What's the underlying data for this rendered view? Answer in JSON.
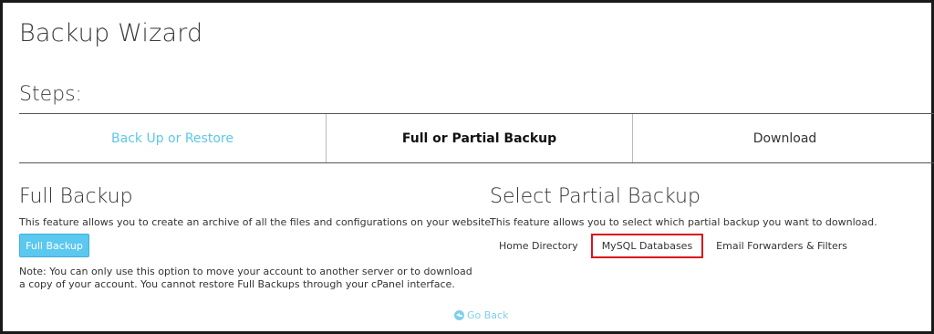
{
  "page": {
    "title": "Backup Wizard",
    "steps_heading": "Steps:"
  },
  "steps": [
    {
      "label": "Back Up or Restore",
      "state": "completed"
    },
    {
      "label": "Full or Partial Backup",
      "state": "current"
    },
    {
      "label": "Download",
      "state": "upcoming"
    }
  ],
  "full_backup": {
    "title": "Full Backup",
    "description": "This feature allows you to create an archive of all the files and configurations on your website.",
    "button_label": "Full Backup",
    "note": "Note: You can only use this option to move your account to another server or to download a copy of your account. You cannot restore Full Backups through your cPanel interface."
  },
  "partial_backup": {
    "title": "Select Partial Backup",
    "description": "This feature allows you to select which partial backup you want to download.",
    "options": [
      {
        "label": "Home Directory",
        "highlighted": false
      },
      {
        "label": "MySQL Databases",
        "highlighted": true
      },
      {
        "label": "Email Forwarders & Filters",
        "highlighted": false
      }
    ]
  },
  "go_back": {
    "label": "Go Back",
    "icon": "arrow-circle-left-icon"
  },
  "colors": {
    "accent": "#5bc8f0",
    "completed_step": "#5bc8e8",
    "highlight_border": "#d9141c"
  }
}
